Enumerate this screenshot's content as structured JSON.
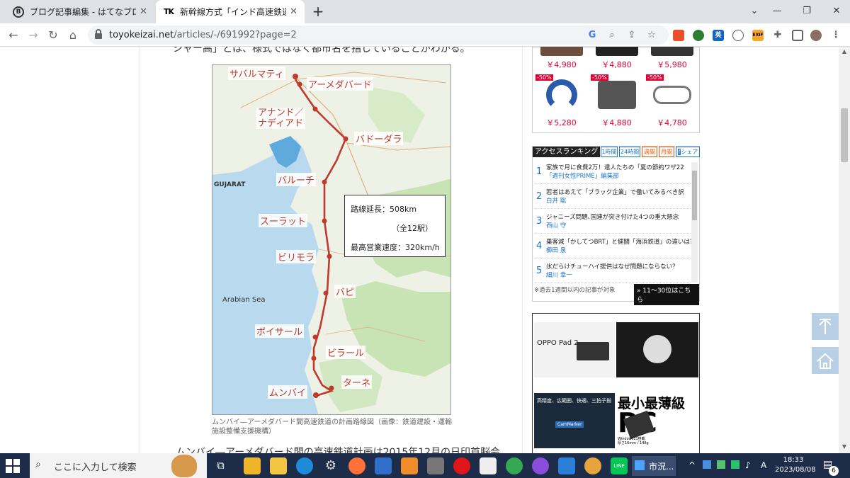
{
  "browser": {
    "tabs": [
      {
        "title": "ブログ記事編集 - はてなブログ",
        "favicon": "B"
      },
      {
        "title": "新幹線方式「インド高速鉄道」はどこ",
        "favicon": "TK"
      }
    ],
    "url_domain": "toyokeizai.net",
    "url_path": "/articles/-/691992?page=2"
  },
  "article": {
    "top_partial_text": "シャー高」とは、様式ではなく都市名を指していることがわかる。",
    "bottom_partial_text": "ムンバイ―アーメダバード間の高速鉄道計画は2015年12月の日印首脳会",
    "map": {
      "stations": [
        "サバルマティ",
        "アーメダバード",
        "アナンド／\nナディアド",
        "バドーダラ",
        "バルーチ",
        "スーラット",
        "ビリモラ",
        "バピ",
        "ボイサール",
        "ビラール",
        "ターネ",
        "ムンバイ"
      ],
      "region_label": "GUJARAT",
      "sea_label": "Arabian Sea",
      "info_length": "路線延長：508km",
      "info_stations": "（全12駅）",
      "info_speed": "最高営業速度：320km/h",
      "route_color": "#c0392b"
    },
    "caption": "ムンバイ―アーメダバード間高速鉄道の計画路線図（画像：鉄道建設・運輸施設整備支援機構）"
  },
  "sidebar": {
    "products_row1": [
      "￥4,980",
      "￥4,880",
      "￥5,980"
    ],
    "products_row2": [
      {
        "badge": "-50%",
        "price": "￥5,280"
      },
      {
        "badge": "-50%",
        "price": "￥4,880"
      },
      {
        "badge": "-50%",
        "price": "￥4,780"
      }
    ],
    "ranking": {
      "title": "アクセスランキング",
      "tabs": [
        "1時間",
        "24時間",
        "週間",
        "月間",
        "シェア"
      ],
      "items": [
        {
          "num": "1",
          "title": "家族で月に食費2万！達人たちの「夏の節約ワザ22",
          "author": "「週刊女性PRIME」編集部"
        },
        {
          "num": "2",
          "title": "若者はあえて「ブラック企業」で働いてみるべき訳",
          "author": "白井 聡"
        },
        {
          "num": "3",
          "title": "ジャニーズ問題､国連が突き付けた4つの重大懸念",
          "author": "西山 守"
        },
        {
          "num": "4",
          "title": "乗客減「かしてつBRT」と健闘「海浜鉄道」の違いは?",
          "author": "櫛田 泉"
        },
        {
          "num": "5",
          "title": "氷だらけチューハイ提供はなぜ問題にならない？",
          "author": "細川 幸一"
        }
      ],
      "note": "※過去1週間以内の記事が対象",
      "more": "» 11〜30位はこちら"
    },
    "ad": {
      "product1": "OPPO Pad 2",
      "headline": "最小最薄級",
      "brand": "PC",
      "subcopy": "高精度、広範囲、快適、三拍子揃った",
      "device_label": "CamMarker",
      "spec": "Windows11搭載\n厚さ16mm / 148g"
    }
  },
  "taskbar": {
    "search_placeholder": "ここに入力して検索",
    "app_label": "市況...",
    "ime": "A",
    "time": "18:33",
    "date": "2023/08/08",
    "notification_count": "6"
  }
}
